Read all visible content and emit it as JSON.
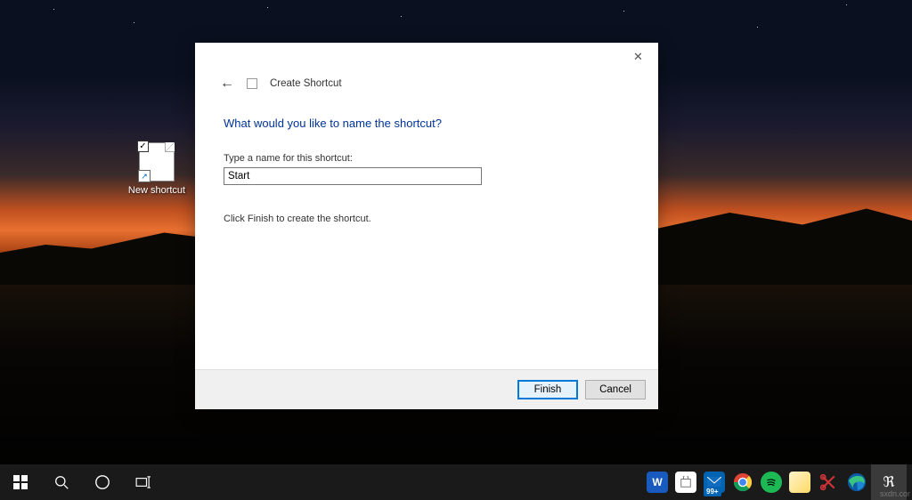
{
  "desktop": {
    "icon_label": "New shortcut"
  },
  "dialog": {
    "wizard_title": "Create Shortcut",
    "heading": "What would you like to name the shortcut?",
    "name_label": "Type a name for this shortcut:",
    "name_value": "Start",
    "helper_text": "Click Finish to create the shortcut.",
    "finish_button": "Finish",
    "cancel_button": "Cancel"
  },
  "taskbar": {
    "badge_count": "99+"
  },
  "watermark": "sxdn.cor"
}
